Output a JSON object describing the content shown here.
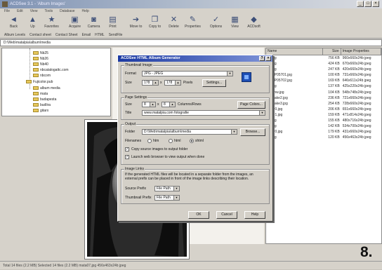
{
  "window": {
    "title": "ACDSee 3.1 - 'Album Images'",
    "minimize": "_",
    "maximize": "□",
    "close": "×"
  },
  "menu": [
    "File",
    "Edit",
    "View",
    "Tools",
    "Database",
    "Help"
  ],
  "toolbar": [
    {
      "label": "Back",
      "icon": "back-icon",
      "glyph": "◄"
    },
    {
      "label": "Up",
      "icon": "up-icon",
      "glyph": "▲"
    },
    {
      "label": "Favorites",
      "icon": "favorites-icon",
      "glyph": "★"
    },
    {
      "label": "Acquire",
      "icon": "acquire-icon",
      "glyph": "▣"
    },
    {
      "label": "Camera",
      "icon": "camera-icon",
      "glyph": "◙"
    },
    {
      "label": "Print",
      "icon": "print-icon",
      "glyph": "▤"
    },
    {
      "label": "Move to",
      "icon": "move-to-icon",
      "glyph": "➔"
    },
    {
      "label": "Copy to",
      "icon": "copy-to-icon",
      "glyph": "❐"
    },
    {
      "label": "Delete",
      "icon": "delete-icon",
      "glyph": "✕"
    },
    {
      "label": "Properties",
      "icon": "properties-icon",
      "glyph": "✎"
    },
    {
      "label": "Options",
      "icon": "options-icon",
      "glyph": "✓"
    },
    {
      "label": "View",
      "icon": "view-icon",
      "glyph": "▦"
    },
    {
      "label": "ACDsoft",
      "icon": "acdsoft-icon",
      "glyph": "◆"
    }
  ],
  "linkbar": [
    "Album Levels",
    "Contact sheet",
    "Contact Sheet",
    "Email",
    "HTML",
    "SendFile"
  ],
  "address": "D:\\Web\\matalpia\\album\\media",
  "tree": [
    "Nb25",
    "Nb26",
    "Nb40",
    "nbcatalogattc.com",
    "nbcom",
    "Fujicolor.pub",
    "album media",
    "mata",
    "budapesta",
    "budlira",
    "gitarx"
  ],
  "filelist": {
    "headers": [
      "Name",
      "Size",
      "Image Properties"
    ],
    "rows": [
      [
        "jpg",
        "756 KB",
        "960x660x24b jpeg"
      ],
      [
        "jpg",
        "424 KB",
        "670x660x24b jpeg"
      ],
      [
        "jpg",
        "247 KB",
        "420x660x24b jpeg"
      ],
      [
        "CP05701.jpg",
        "100 KB",
        "731x660x24b jpeg"
      ],
      [
        "CP05702.jpg",
        "169 KB",
        "646x611x24b jpeg"
      ],
      [
        "jpg",
        "137 KB",
        "425x220x24b jpeg"
      ],
      [
        "Pnw.jpg",
        "104 KB",
        "548x748x24b jpeg"
      ],
      [
        "stake2.jpg",
        "236 KB",
        "721x660x24b jpeg"
      ],
      [
        "stake3.jpg",
        "254 KB",
        "728x660x24b jpeg"
      ],
      [
        "hr0.jpg",
        "206 KB",
        "651x660x24b jpeg"
      ],
      [
        "hr1.jpg",
        "159 KB",
        "471x814x24b jpeg"
      ],
      [
        "jpg",
        "155 KB",
        "480x716x24b jpeg"
      ],
      [
        "jpg",
        "142 KB",
        "534x700x24b jpeg"
      ],
      [
        "hr0.jpg",
        "179 KB",
        "431x660x24b jpeg"
      ],
      [
        "jpg",
        "120 KB",
        "456x463x24b jpeg"
      ]
    ]
  },
  "statusbar": "Total 14 files (2.2 MB)   Selected 14 files (2.2 MB)   mata07.jpg   456x463x24b jpeg",
  "figure_number": "8.",
  "dialog": {
    "title": "ACDSee HTML Album Generator",
    "help_btn": "?",
    "close_btn": "×",
    "thumbnail": {
      "group": "Thumbnail Image",
      "format_label": "Format",
      "format_value": "JPG - JPEG",
      "size_label": "Size",
      "width": "178",
      "height": "178",
      "unit": "Pixels",
      "settings_btn": "Settings..."
    },
    "page": {
      "group": "Page Settings",
      "size_label": "Size",
      "cols": "8",
      "rows": "8",
      "unit": "Columns/Rows",
      "colors_btn": "Page Colors...",
      "title_label": "Title",
      "title_value": "www.matalpia.com fotografie"
    },
    "output": {
      "group": "Output",
      "folder_label": "Folder",
      "folder_value": "D:\\Web\\matalpia\\album\\media",
      "browse_btn": "Browse...",
      "filenames_label": "Filenames",
      "radio_options": [
        "htm",
        "html",
        "shtml"
      ],
      "radio_selected": 2,
      "check1": "Copy source images to output folder",
      "check2": "Launch web browser to view output when done"
    },
    "links": {
      "group": "Image Links",
      "note": "If the generated HTML files will be located in a separate folder from the images, an external prefix can be placed in front of the image links describing their location.",
      "source_label": "Source Prefix",
      "source_value": "File Path",
      "thumb_label": "Thumbnail Prefix",
      "thumb_value": "File Path"
    },
    "ok_btn": "OK",
    "cancel_btn": "Cancel",
    "help_btn2": "Help"
  }
}
